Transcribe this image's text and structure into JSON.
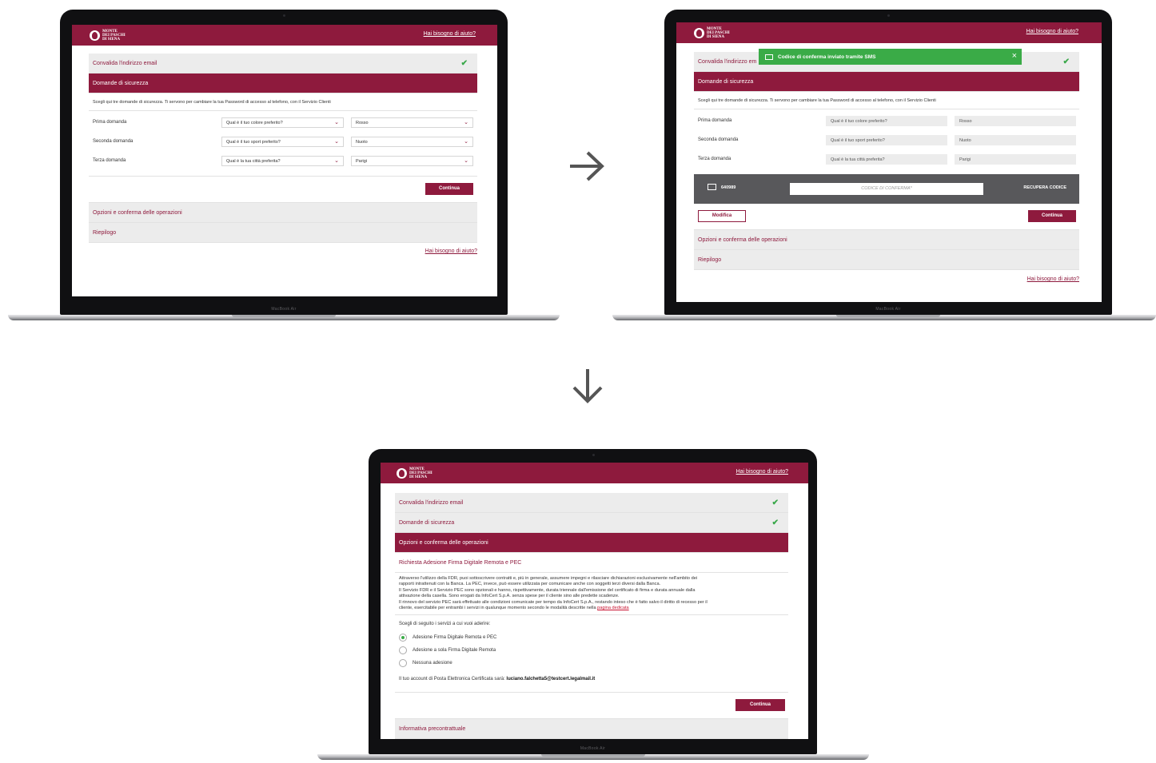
{
  "brand": {
    "logo_lines": [
      "MONTE",
      "DEI PASCHI",
      "DI SIENA"
    ],
    "primary_color": "#8e1a3d",
    "success_color": "#3aab47"
  },
  "laptop": {
    "model_label": "MacBook Air"
  },
  "common": {
    "help_link": "Hai bisogno di aiuto?",
    "continue_label": "Continua",
    "check_icon": "✔"
  },
  "screen1": {
    "steps": {
      "validate_email": "Convalida l'indirizzo email",
      "security_questions": "Domande di sicurezza",
      "options": "Opzioni e conferma delle operazioni",
      "summary": "Riepilogo"
    },
    "intro": "Scegli qui tre domande di sicurezza. Ti servono per cambiare la tua Password di accesso al telefono, con il Servizio Clienti",
    "questions": [
      {
        "label": "Prima domanda",
        "question": "Qual è il tuo colore preferito?",
        "answer": "Rosso"
      },
      {
        "label": "Seconda domanda",
        "question": "Qual è il tuo sport preferito?",
        "answer": "Nuoto"
      },
      {
        "label": "Terza domanda",
        "question": "Qual è la tua città preferita?",
        "answer": "Parigi"
      }
    ]
  },
  "screen2": {
    "toast": "Codice di conferma inviato tramite SMS",
    "steps": {
      "validate_email": "Convalida l'indirizzo em",
      "security_questions": "Domande di sicurezza",
      "options": "Opzioni e conferma delle operazioni",
      "summary": "Riepilogo"
    },
    "intro": "Scegli qui tre domande di sicurezza. Ti servono per cambiare la tua Password di accesso al telefono, con il Servizio Clienti",
    "questions": [
      {
        "label": "Prima domanda",
        "question": "Qual è il tuo colore preferito?",
        "answer": "Rosso"
      },
      {
        "label": "Seconda domanda",
        "question": "Qual è il tuo sport preferito?",
        "answer": "Nuoto"
      },
      {
        "label": "Terza domanda",
        "question": "Qual è la tua città preferita?",
        "answer": "Parigi"
      }
    ],
    "code_bar": {
      "sms_code": "640989",
      "input_placeholder": "CODICE DI CONFERMA*",
      "recover_label": "RECUPERA CODICE"
    },
    "modify_label": "Modifica"
  },
  "screen3": {
    "steps": {
      "validate_email": "Convalida l'indirizzo email",
      "security_questions": "Domande di sicurezza",
      "options": "Opzioni e conferma delle operazioni",
      "request_title": "Richiesta Adesione Firma Digitale Remota e PEC",
      "pre_contract": "Informativa precontrattuale"
    },
    "body_lines": [
      "Attraverso l'utilizzo della FDR, puoi sottoscrivere contratti e, più in generale, assumere impegni e rilasciare dichiarazioni esclusivamente nell'ambito dei",
      "rapporti intrattenuti con la Banca. La PEC, invece, può essere utilizzata per comunicare anche con soggetti terzi diversi dalla Banca.",
      "Il Servizio FDR e il Servizio PEC sono opzionali e hanno, rispettivamente, durata triennale dall'emissione del certificato di firma e durata annuale dalla",
      "attivazione della casella. Sono erogati da InfoCert S.p.A. senza spese per il cliente sino alle predette scadenze.",
      "Il rinnovo del servizio PEC sarà effettuato alle condizioni comunicate per tempo da InfoCert S.p.A., restando inteso che è fatto salvo il diritto di recesso per il"
    ],
    "body_last_prefix": "cliente, esercitabile per entrambi i servizi in qualunque momento secondo le modalità descritte nella",
    "body_link": "pagina dedicata",
    "choose_label": "Scegli di seguito i servizi a cui vuoi aderire:",
    "options": [
      {
        "label": "Adesione Firma Digitale Remota e PEC",
        "selected": true
      },
      {
        "label": "Adesione a sola Firma Digitale Remota",
        "selected": false
      },
      {
        "label": "Nessuna adesione",
        "selected": false
      }
    ],
    "pec_prefix": "Il tuo account di Posta Elettronica Certificata sarà:",
    "pec_address": "luciano.falchetta5@testcert.legalmail.it"
  }
}
